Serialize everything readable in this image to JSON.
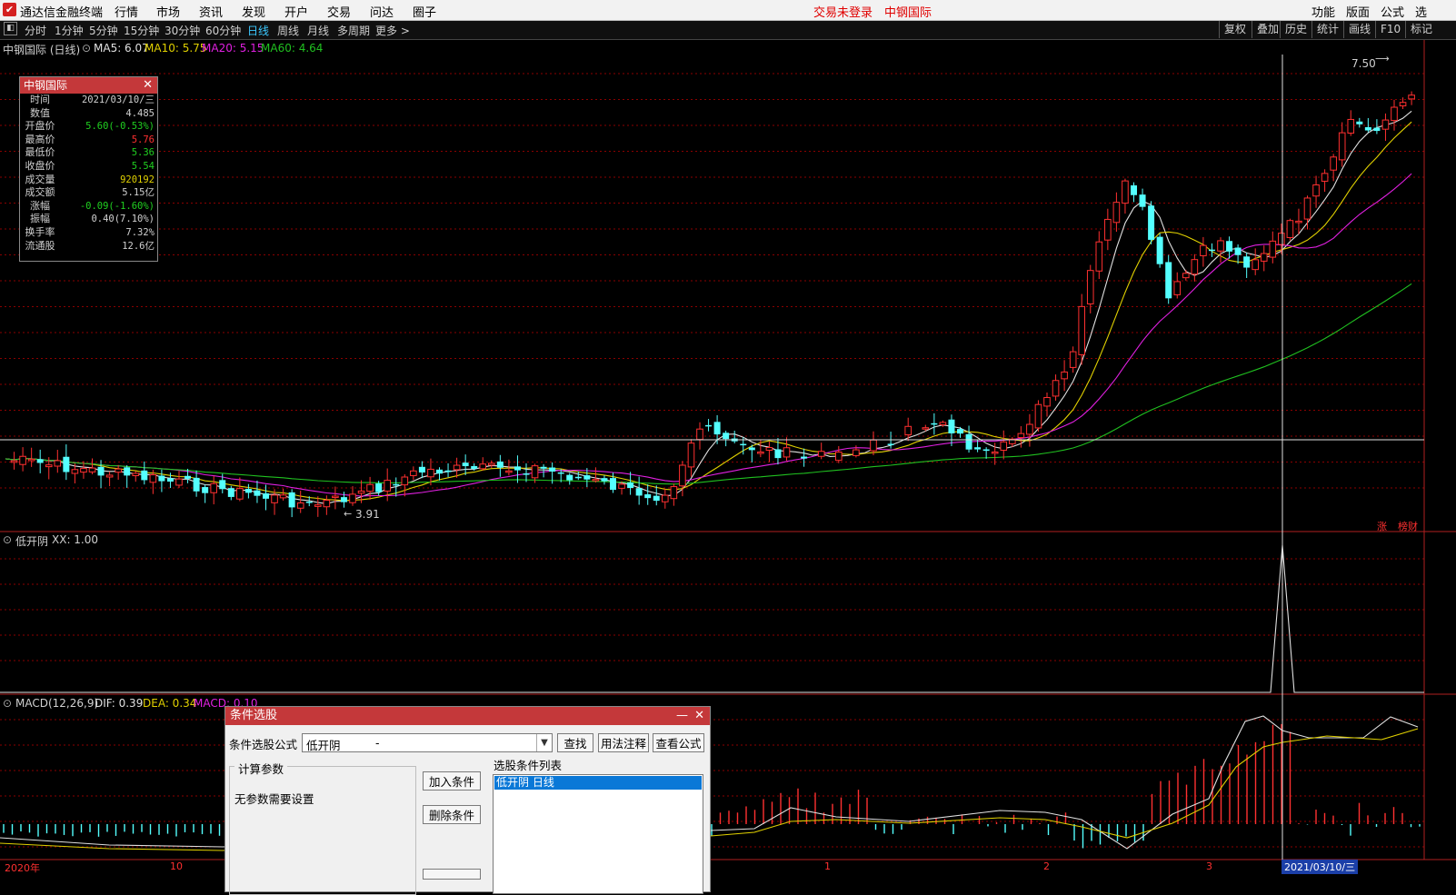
{
  "menu": {
    "app_title": "通达信金融终端",
    "items": [
      "行情",
      "市场",
      "资讯",
      "发现",
      "开户",
      "交易",
      "问达",
      "圈子"
    ],
    "status_trade": "交易未登录",
    "status_stock": "中钢国际",
    "right_items": [
      "功能",
      "版面",
      "公式",
      "选"
    ]
  },
  "toolbar": {
    "periods": [
      "分时",
      "1分钟",
      "5分钟",
      "15分钟",
      "30分钟",
      "60分钟",
      "日线",
      "周线",
      "月线",
      "多周期",
      "更多 >"
    ],
    "active": "日线",
    "right_items": [
      "复权",
      "叠加",
      "历史",
      "统计",
      "画线",
      "F10",
      "标记"
    ]
  },
  "main_chart": {
    "title": "中钢国际 (日线)",
    "ma_labels": [
      "MA5: 6.07",
      "MA10: 5.75",
      "MA20: 5.15",
      "MA60: 4.64"
    ],
    "ma_colors": [
      "#e0e0e0",
      "#e0d000",
      "#e020e0",
      "#20c020"
    ],
    "high_label": "7.50",
    "low_label": "3.91",
    "corner_tags": [
      "涨",
      "榜财"
    ]
  },
  "info_box": {
    "title": "中钢国际",
    "rows": [
      {
        "k": "时间",
        "v": "2021/03/10/三",
        "c": "#d0d0d0"
      },
      {
        "k": "数值",
        "v": "4.485",
        "c": "#d0d0d0"
      },
      {
        "k": "开盘价",
        "v": "5.60(-0.53%)",
        "c": "#20d020"
      },
      {
        "k": "最高价",
        "v": "5.76",
        "c": "#ff3030"
      },
      {
        "k": "最低价",
        "v": "5.36",
        "c": "#20d020"
      },
      {
        "k": "收盘价",
        "v": "5.54",
        "c": "#20d020"
      },
      {
        "k": "成交量",
        "v": "920192",
        "c": "#e0d000"
      },
      {
        "k": "成交额",
        "v": "5.15亿",
        "c": "#d0d0d0"
      },
      {
        "k": "涨幅",
        "v": "-0.09(-1.60%)",
        "c": "#20d020"
      },
      {
        "k": "振幅",
        "v": "0.40(7.10%)",
        "c": "#d0d0d0"
      },
      {
        "k": "换手率",
        "v": "7.32%",
        "c": "#d0d0d0"
      },
      {
        "k": "流通股",
        "v": "12.6亿",
        "c": "#d0d0d0"
      }
    ]
  },
  "indicator": {
    "title": "低开阴",
    "value_label": "XX: 1.00"
  },
  "macd": {
    "title": "MACD(12,26,9)",
    "dif": "DIF: 0.39",
    "dea": "DEA: 0.34",
    "macd": "MACD: 0.10"
  },
  "x_axis": {
    "labels": [
      "2020年",
      "10",
      "1",
      "2",
      "3",
      "2021/03/10/三"
    ]
  },
  "dialog": {
    "title": "条件选股",
    "formula_label": "条件选股公式",
    "formula_value": "低开阴",
    "formula_dash": "-",
    "find_button": "查找",
    "usage_button": "用法注释",
    "view_button": "查看公式",
    "params_title": "计算参数",
    "no_params": "无参数需要设置",
    "add_button": "加入条件",
    "delete_button": "删除条件",
    "list_title": "选股条件列表",
    "list_items": [
      "低开阴   日线"
    ]
  },
  "colors": {
    "up": "#ff3030",
    "down": "#54ffff",
    "grid": "#8b0000",
    "dialog_title": "#c4383a",
    "selected": "#0a78d7"
  }
}
